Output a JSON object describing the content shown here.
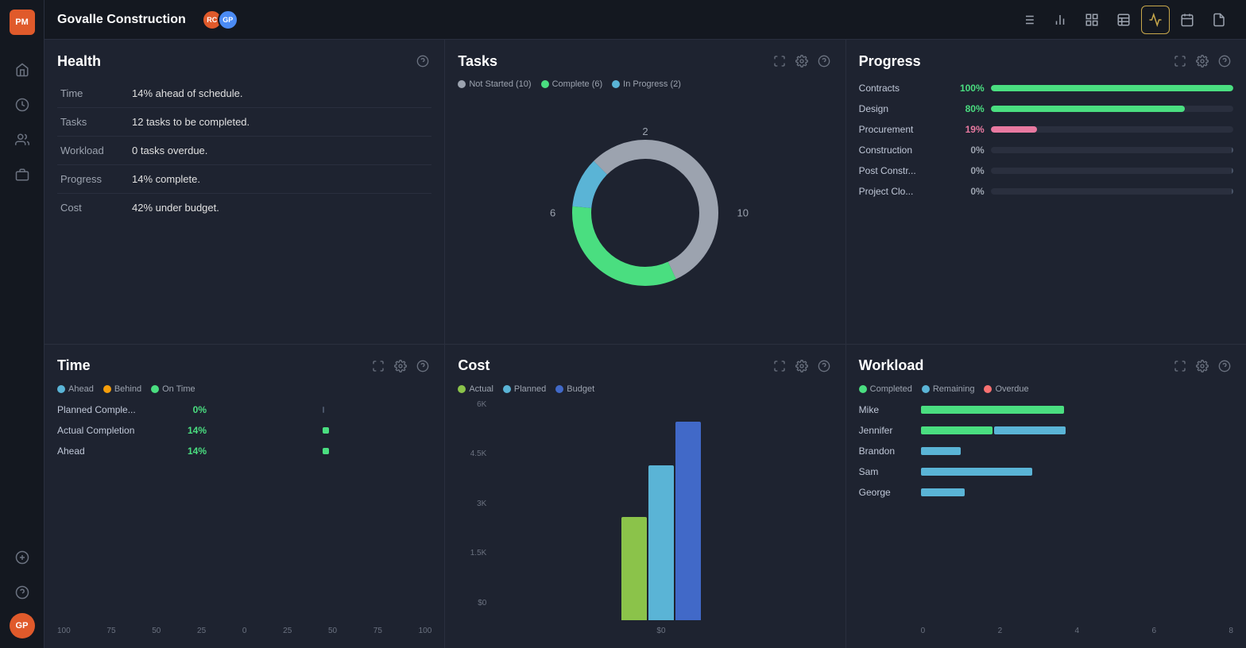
{
  "app": {
    "logo": "PM",
    "title": "Govalle Construction",
    "avatars": [
      {
        "initials": "RC",
        "color": "orange"
      },
      {
        "initials": "GP",
        "color": "blue"
      }
    ]
  },
  "toolbar": {
    "icons": [
      {
        "name": "list-icon",
        "label": "List"
      },
      {
        "name": "bar-chart-icon",
        "label": "Bar Chart"
      },
      {
        "name": "grid-icon",
        "label": "Grid"
      },
      {
        "name": "table-icon",
        "label": "Table"
      },
      {
        "name": "pulse-icon",
        "label": "Pulse",
        "active": true
      },
      {
        "name": "calendar-icon",
        "label": "Calendar"
      },
      {
        "name": "document-icon",
        "label": "Document"
      }
    ]
  },
  "sidebar": {
    "items": [
      {
        "name": "home-icon",
        "label": "Home"
      },
      {
        "name": "clock-icon",
        "label": "Timeline"
      },
      {
        "name": "users-icon",
        "label": "Team"
      },
      {
        "name": "briefcase-icon",
        "label": "Projects"
      }
    ],
    "bottom": [
      {
        "name": "plus-icon",
        "label": "Add"
      },
      {
        "name": "question-icon",
        "label": "Help"
      }
    ]
  },
  "health": {
    "title": "Health",
    "rows": [
      {
        "label": "Time",
        "value": "14% ahead of schedule."
      },
      {
        "label": "Tasks",
        "value": "12 tasks to be completed."
      },
      {
        "label": "Workload",
        "value": "0 tasks overdue."
      },
      {
        "label": "Progress",
        "value": "14% complete."
      },
      {
        "label": "Cost",
        "value": "42% under budget."
      }
    ]
  },
  "tasks": {
    "title": "Tasks",
    "legend": [
      {
        "label": "Not Started (10)",
        "color": "#9ca3af"
      },
      {
        "label": "Complete (6)",
        "color": "#4ade80"
      },
      {
        "label": "In Progress (2)",
        "color": "#5ab4d6"
      }
    ],
    "donut": {
      "not_started": 10,
      "complete": 6,
      "in_progress": 2,
      "total": 18,
      "label_left": "6",
      "label_right": "10",
      "label_top": "2"
    }
  },
  "progress": {
    "title": "Progress",
    "rows": [
      {
        "label": "Contracts",
        "pct": "100%",
        "value": 100,
        "color": "green"
      },
      {
        "label": "Design",
        "pct": "80%",
        "value": 80,
        "color": "green"
      },
      {
        "label": "Procurement",
        "pct": "19%",
        "value": 19,
        "color": "pink"
      },
      {
        "label": "Construction",
        "pct": "0%",
        "value": 0,
        "color": "gray"
      },
      {
        "label": "Post Constr...",
        "pct": "0%",
        "value": 0,
        "color": "gray"
      },
      {
        "label": "Project Clo...",
        "pct": "0%",
        "value": 0,
        "color": "gray"
      }
    ]
  },
  "time": {
    "title": "Time",
    "legend": [
      {
        "label": "Ahead",
        "color": "#5ab4d6"
      },
      {
        "label": "Behind",
        "color": "#f59e0b"
      },
      {
        "label": "On Time",
        "color": "#4ade80"
      }
    ],
    "rows": [
      {
        "label": "Planned Comple...",
        "pct": "0%",
        "bar_width_pct": 0
      },
      {
        "label": "Actual Completion",
        "pct": "14%",
        "bar_width_pct": 14
      },
      {
        "label": "Ahead",
        "pct": "14%",
        "bar_width_pct": 14
      }
    ],
    "axis": [
      "100",
      "75",
      "50",
      "25",
      "0",
      "25",
      "50",
      "75",
      "100"
    ]
  },
  "cost": {
    "title": "Cost",
    "legend": [
      {
        "label": "Actual",
        "color": "#8bc34a"
      },
      {
        "label": "Planned",
        "color": "#5ab4d6"
      },
      {
        "label": "Budget",
        "color": "#4169c8"
      }
    ],
    "yaxis": [
      "6K",
      "4.5K",
      "3K",
      "1.5K",
      "$0"
    ],
    "bars": [
      {
        "actual": 45,
        "planned": 68,
        "budget": 90
      }
    ]
  },
  "workload": {
    "title": "Workload",
    "legend": [
      {
        "label": "Completed",
        "color": "#4ade80"
      },
      {
        "label": "Remaining",
        "color": "#5ab4d6"
      },
      {
        "label": "Overdue",
        "color": "#f87171"
      }
    ],
    "rows": [
      {
        "label": "Mike",
        "completed": 70,
        "remaining": 0,
        "overdue": 0
      },
      {
        "label": "Jennifer",
        "completed": 35,
        "remaining": 35,
        "overdue": 0
      },
      {
        "label": "Brandon",
        "completed": 0,
        "remaining": 20,
        "overdue": 0
      },
      {
        "label": "Sam",
        "completed": 0,
        "remaining": 55,
        "overdue": 0
      },
      {
        "label": "George",
        "completed": 0,
        "remaining": 22,
        "overdue": 0
      }
    ],
    "xaxis": [
      "0",
      "2",
      "4",
      "6",
      "8"
    ]
  }
}
